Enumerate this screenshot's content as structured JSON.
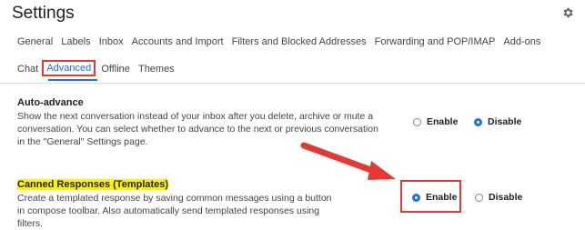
{
  "header": {
    "title": "Settings"
  },
  "tabs": {
    "row1": [
      "General",
      "Labels",
      "Inbox",
      "Accounts and Import",
      "Filters and Blocked Addresses",
      "Forwarding and POP/IMAP",
      "Add-ons"
    ],
    "row2_before": "Chat",
    "active": "Advanced",
    "row2_after": [
      "Offline",
      "Themes"
    ]
  },
  "auto_advance": {
    "title": "Auto-advance",
    "description": "Show the next conversation instead of your inbox after you delete, archive or mute a conversation. You can select whether to advance to the next or previous conversation in the \"General\" Settings page.",
    "enable_label": "Enable",
    "disable_label": "Disable",
    "selected": "Disable"
  },
  "canned_responses": {
    "title": "Canned Responses (Templates)",
    "description": "Create a templated response by saving common messages using a button in compose toolbar. Also automatically send templated responses using filters.",
    "enable_label": "Enable",
    "disable_label": "Disable",
    "selected": "Enable"
  },
  "colors": {
    "accent": "#1a73e8",
    "annotation": "#e53935",
    "highlight": "#fff200"
  },
  "icons": {
    "settings": "gear-icon",
    "pointer": "arrow-annotation"
  }
}
